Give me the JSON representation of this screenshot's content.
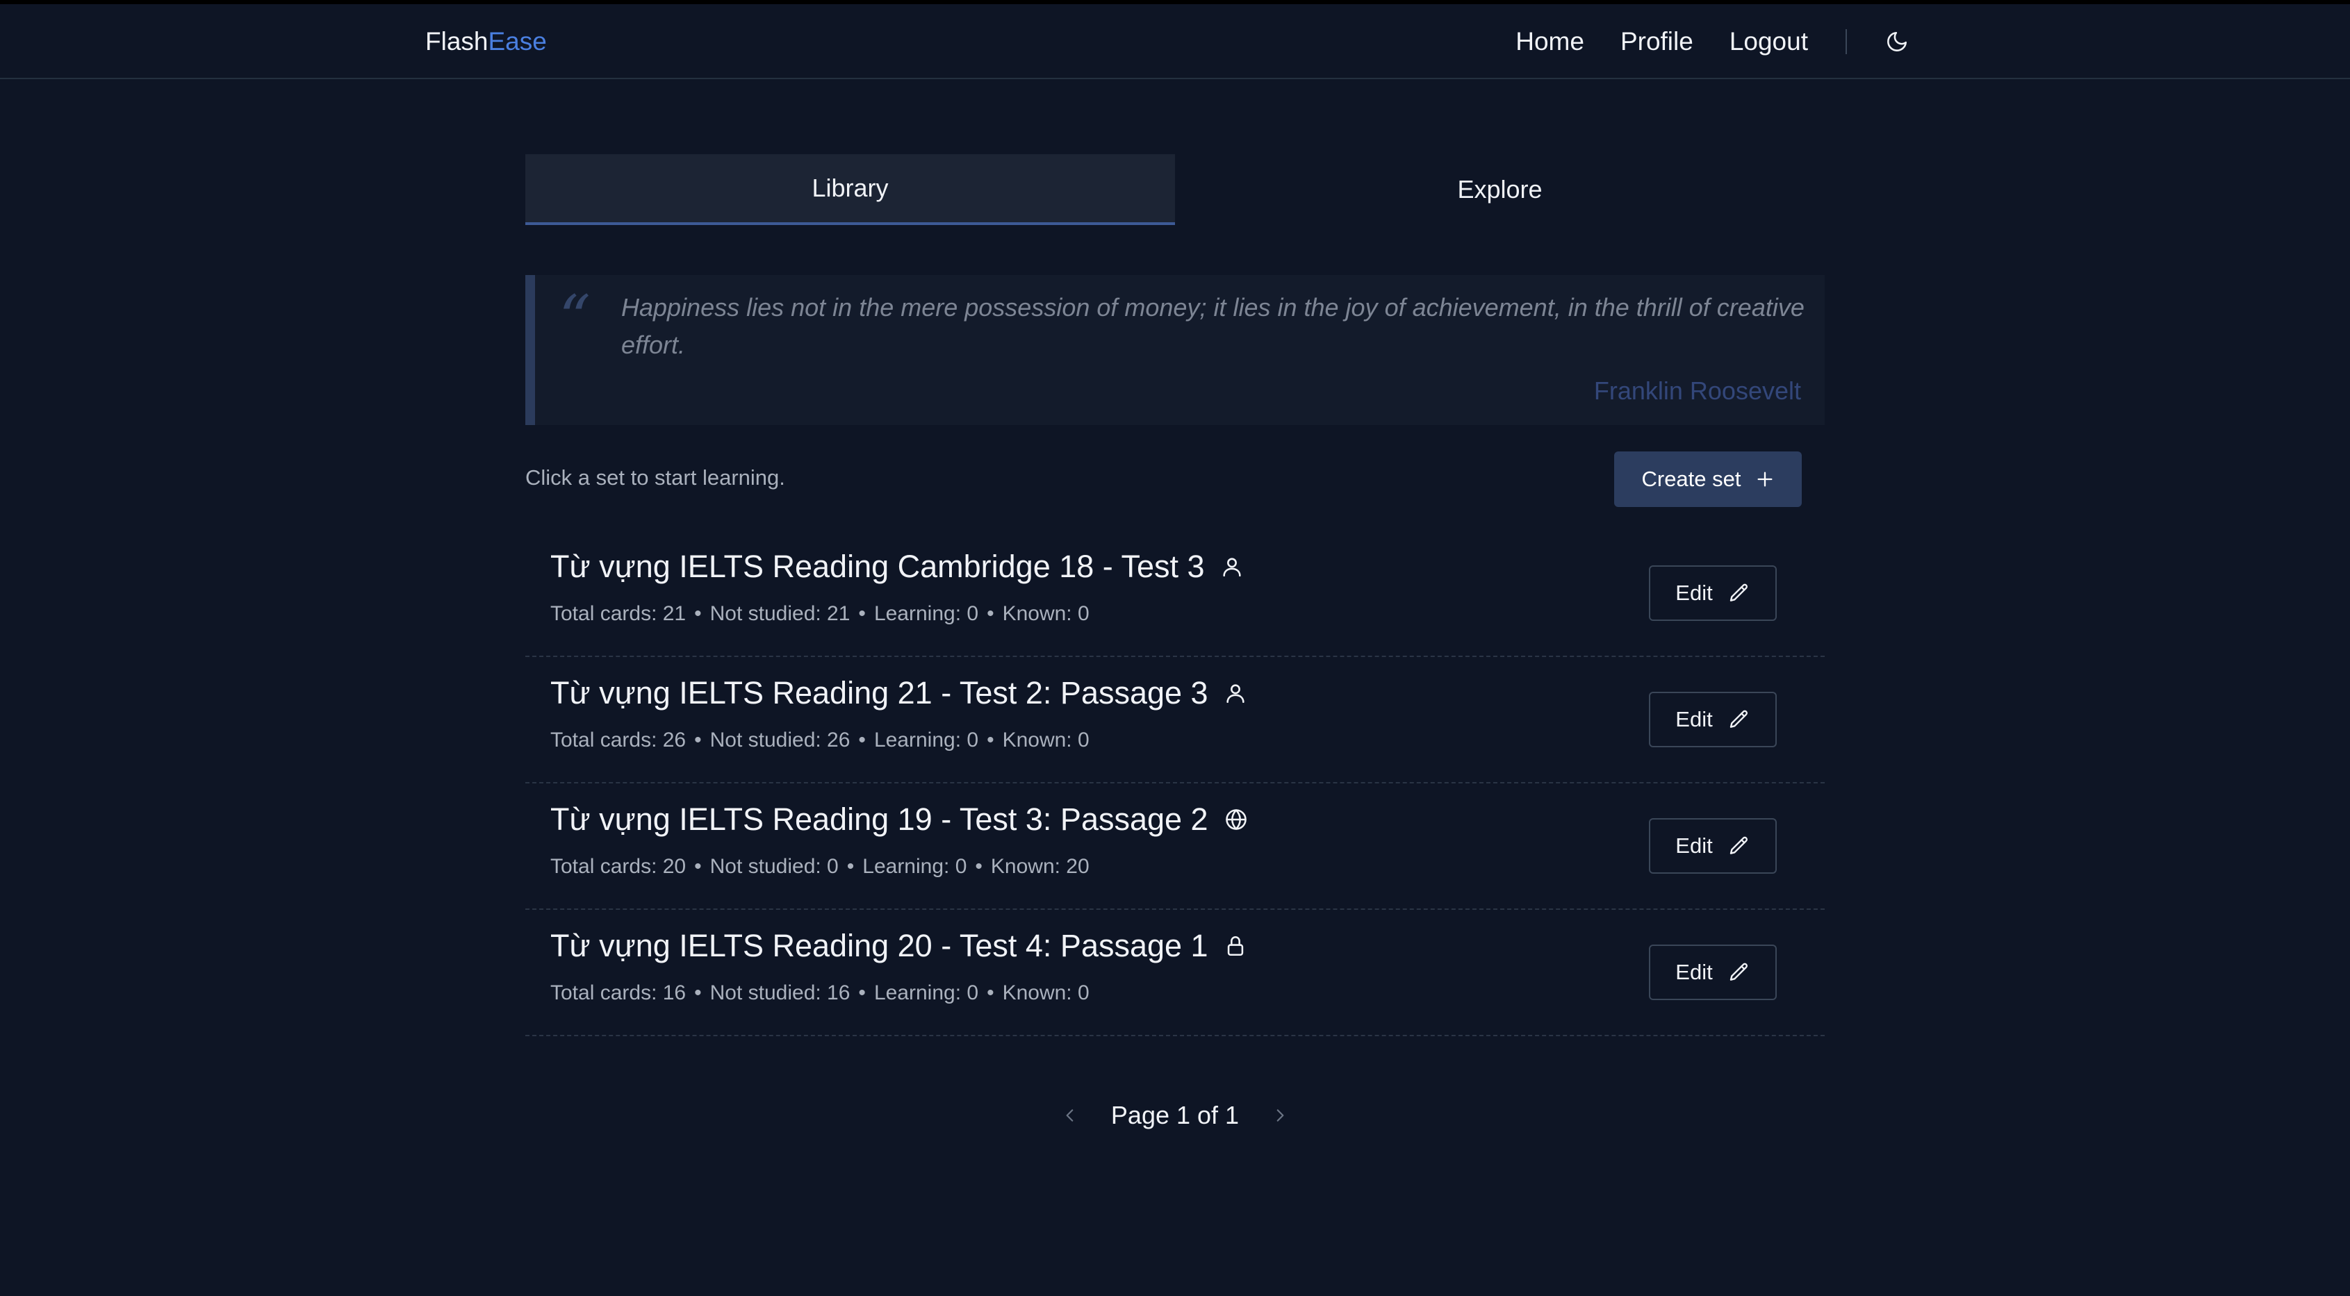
{
  "nav": {
    "brand_part1": "Flash",
    "brand_part2": "Ease",
    "links": [
      "Home",
      "Profile",
      "Logout"
    ],
    "theme_icon": "moon-icon"
  },
  "tabs": [
    {
      "label": "Library",
      "active": true
    },
    {
      "label": "Explore",
      "active": false
    }
  ],
  "quote": {
    "text": "Happiness lies not in the mere possession of money; it lies in the joy of achievement, in the thrill of creative effort.",
    "author": "Franklin Roosevelt"
  },
  "toolbar": {
    "hint": "Click a set to start learning.",
    "create_label": "Create set"
  },
  "sets": [
    {
      "title": "Từ vựng IELTS Reading Cambridge 18 - Test 3",
      "visibility_icon": "user-icon",
      "stats": [
        "Total cards: 21",
        "Not studied: 21",
        "Learning: 0",
        "Known: 0"
      ],
      "edit_label": "Edit"
    },
    {
      "title": "Từ vựng IELTS Reading 21 - Test 2: Passage 3",
      "visibility_icon": "user-icon",
      "stats": [
        "Total cards: 26",
        "Not studied: 26",
        "Learning: 0",
        "Known: 0"
      ],
      "edit_label": "Edit"
    },
    {
      "title": "Từ vựng IELTS Reading 19 - Test 3: Passage 2",
      "visibility_icon": "globe-icon",
      "stats": [
        "Total cards: 20",
        "Not studied: 0",
        "Learning: 0",
        "Known: 20"
      ],
      "edit_label": "Edit"
    },
    {
      "title": "Từ vựng IELTS Reading 20 - Test 4: Passage 1",
      "visibility_icon": "lock-icon",
      "stats": [
        "Total cards: 16",
        "Not studied: 16",
        "Learning: 0",
        "Known: 0"
      ],
      "edit_label": "Edit"
    }
  ],
  "pagination": {
    "label": "Page 1 of 1"
  },
  "colors": {
    "background": "#0e1525",
    "accent": "#4a7fe0",
    "button": "#2c3d5f"
  }
}
